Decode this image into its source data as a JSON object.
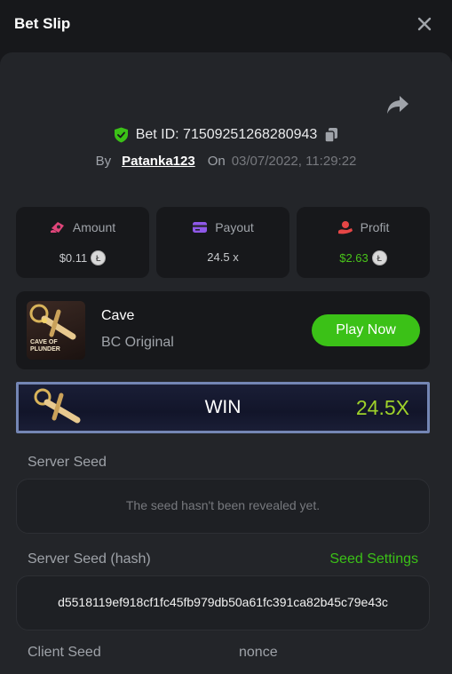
{
  "header": {
    "title": "Bet Slip"
  },
  "bet": {
    "id_label": "Bet ID: 71509251268280943",
    "by_label": "By",
    "username": "Patanka123",
    "on_label": "On",
    "date": "03/07/2022, 11:29:22"
  },
  "stats": {
    "amount": {
      "label": "Amount",
      "value": "$0.11"
    },
    "payout": {
      "label": "Payout",
      "value": "24.5 x"
    },
    "profit": {
      "label": "Profit",
      "value": "$2.63"
    }
  },
  "game": {
    "name": "Cave",
    "provider": "BC Original",
    "thumb_text": "CAVE OF PLUNDER",
    "play_label": "Play Now"
  },
  "result": {
    "status": "WIN",
    "multiplier": "24.5X"
  },
  "server_seed": {
    "label": "Server Seed",
    "value": "The seed hasn't been revealed yet."
  },
  "server_seed_hash": {
    "label": "Server Seed (hash)",
    "settings_link": "Seed Settings",
    "value": "d5518119ef918cf1fc45fb979db50a61fc391ca82b45c79e43c"
  },
  "client_seed": {
    "label": "Client Seed"
  },
  "nonce": {
    "label": "nonce"
  },
  "colors": {
    "accent_green": "#3bc117",
    "multiplier_green": "#9ed12a",
    "shield_green": "#3bc117",
    "profit_green": "#49c31a"
  }
}
